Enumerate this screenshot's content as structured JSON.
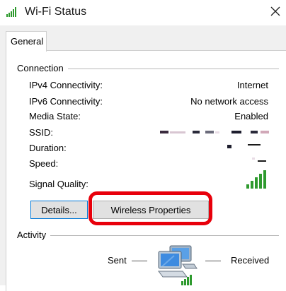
{
  "window": {
    "title": "Wi-Fi Status",
    "close_glyph": "✕"
  },
  "tabs": [
    {
      "label": "General"
    }
  ],
  "connection": {
    "title": "Connection",
    "rows": [
      {
        "label": "IPv4 Connectivity:",
        "value": "Internet"
      },
      {
        "label": "IPv6 Connectivity:",
        "value": "No network access"
      },
      {
        "label": "Media State:",
        "value": "Enabled"
      },
      {
        "label": "SSID:",
        "value": ""
      },
      {
        "label": "Duration:",
        "value": ""
      },
      {
        "label": "Speed:",
        "value": ""
      }
    ],
    "signal_label": "Signal Quality:",
    "signal_bars": 5
  },
  "buttons": {
    "details": "Details...",
    "wireless": "Wireless Properties"
  },
  "activity": {
    "title": "Activity",
    "sent": "Sent",
    "received": "Received"
  },
  "colors": {
    "signal_green": "#2e9a2e",
    "highlight_red": "#e8000b",
    "focus_blue": "#0078d7"
  }
}
